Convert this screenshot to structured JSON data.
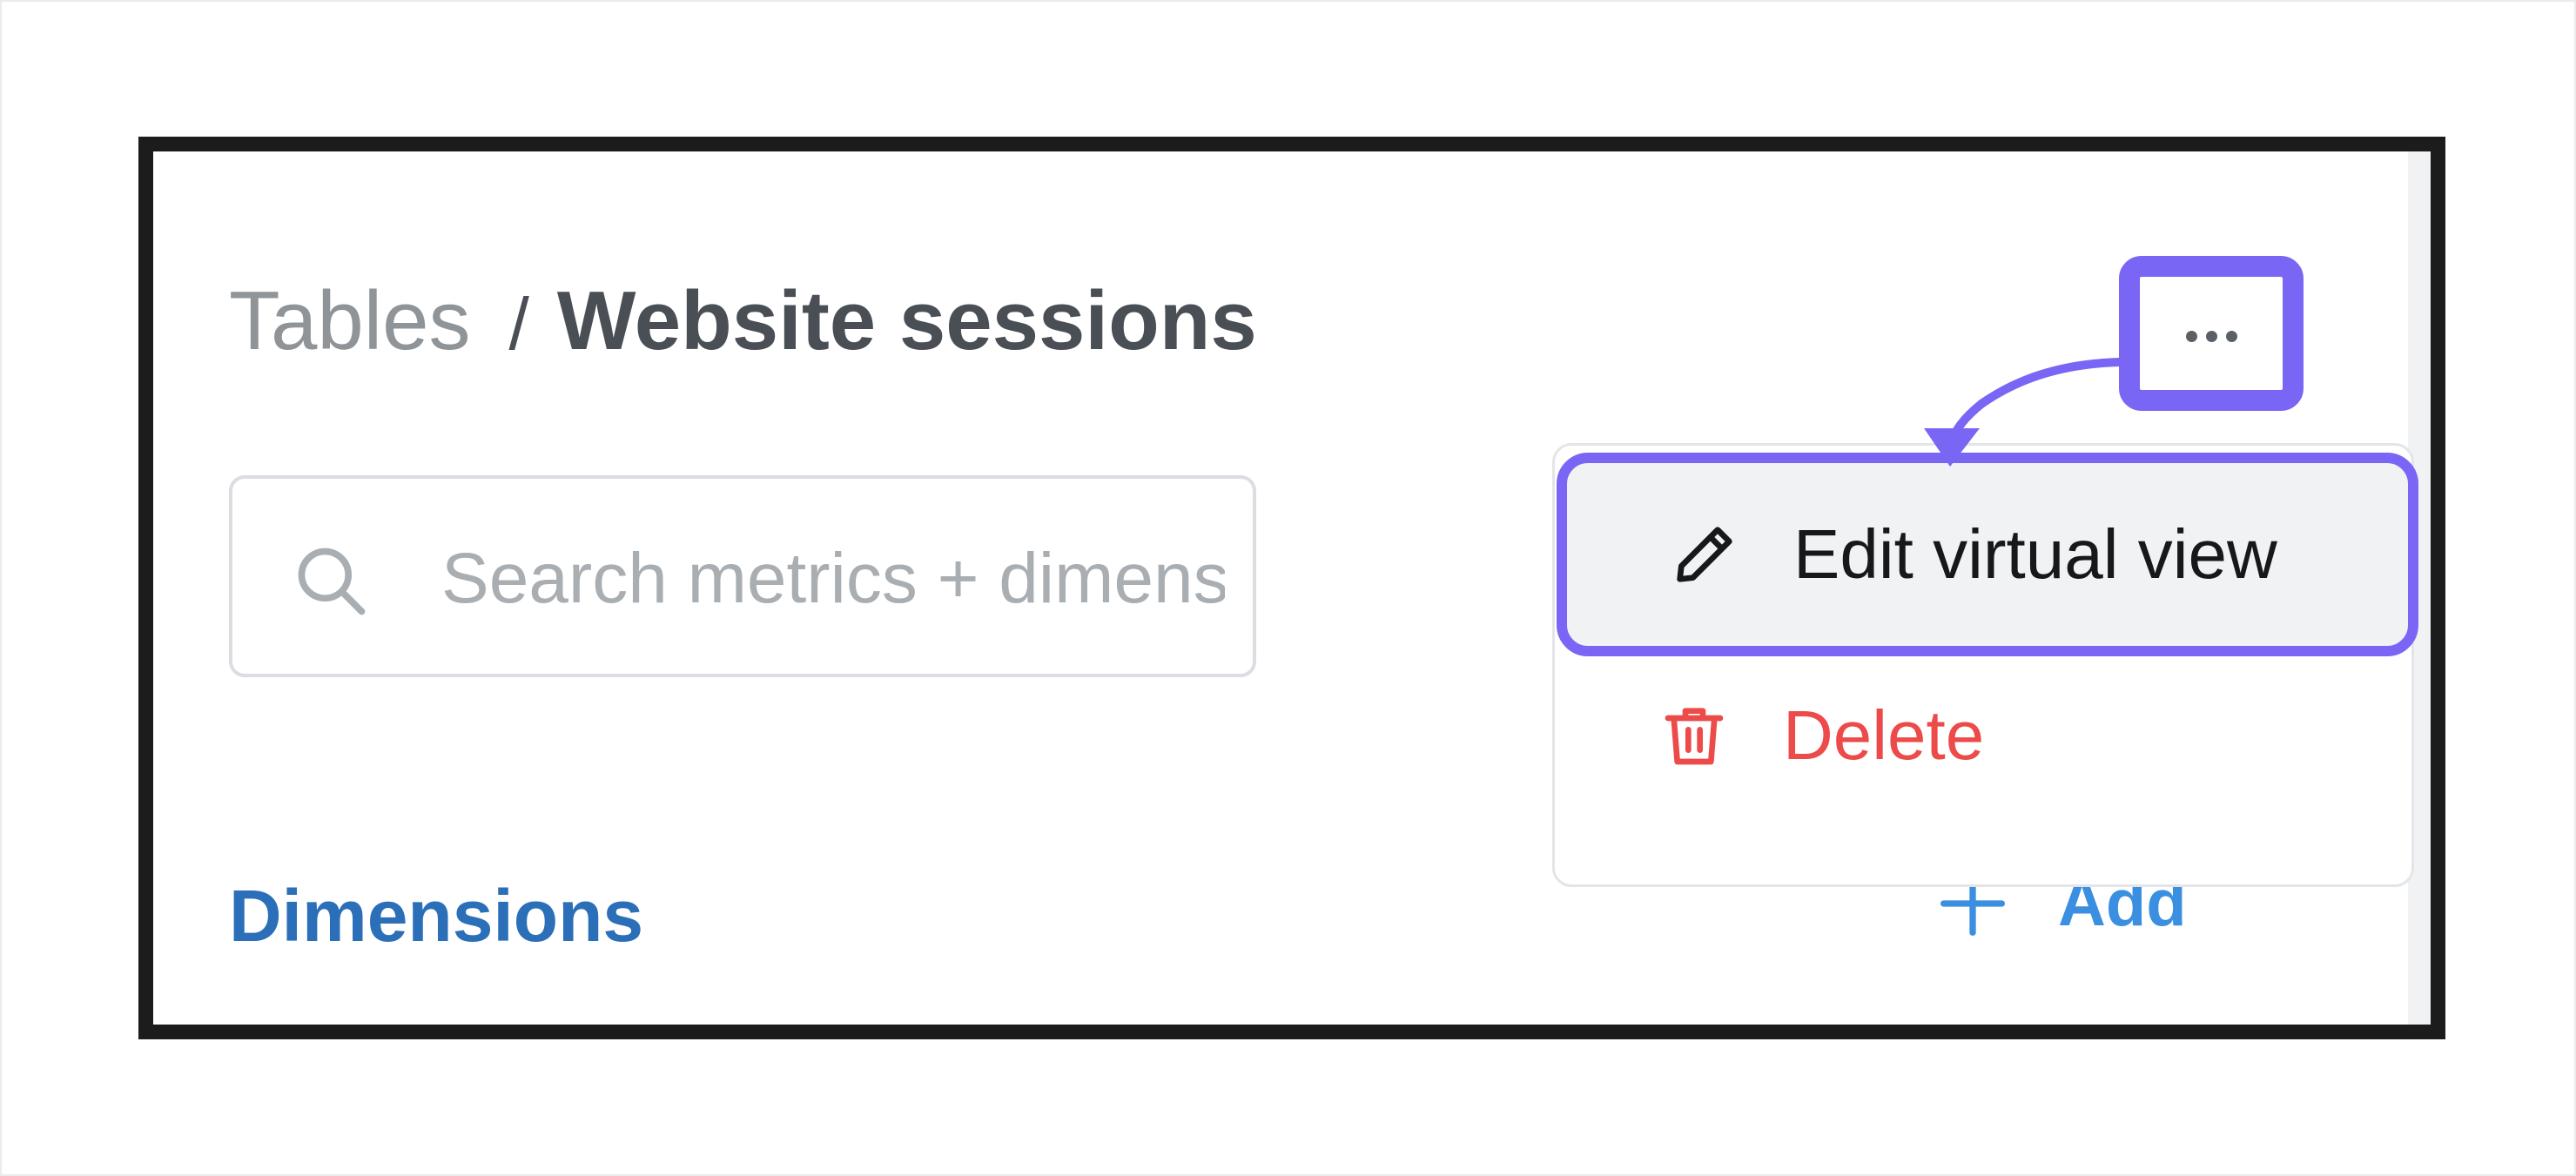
{
  "breadcrumb": {
    "parent": "Tables",
    "separator": "/",
    "current": "Website sessions"
  },
  "search": {
    "placeholder": "Search metrics + dimensions",
    "value": ""
  },
  "sections": {
    "dimensions_title": "Dimensions",
    "add_label": "Add"
  },
  "menu": {
    "more_icon": "more-horizontal-icon",
    "items": [
      {
        "label": "Edit virtual view",
        "icon": "pencil-icon"
      },
      {
        "label": "Delete",
        "icon": "trash-icon"
      }
    ]
  },
  "colors": {
    "highlight": "#7a66f4",
    "link": "#2a6fb8",
    "danger": "#ed4a4a",
    "muted": "#8f9499",
    "text": "#4a4f55"
  }
}
